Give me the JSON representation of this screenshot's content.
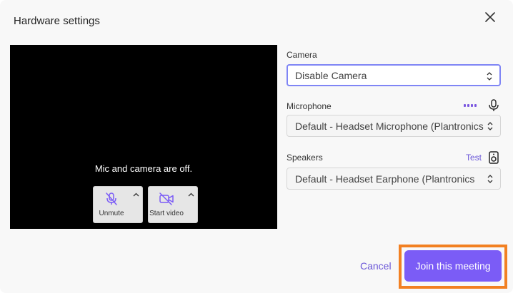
{
  "dialog": {
    "title": "Hardware settings"
  },
  "preview": {
    "message": "Mic and camera are off.",
    "controls": {
      "mic_label": "Unmute",
      "video_label": "Start video"
    }
  },
  "camera": {
    "label": "Camera",
    "selected": "Disable Camera"
  },
  "microphone": {
    "label": "Microphone",
    "selected": "Default - Headset Microphone (Plantronics"
  },
  "speakers": {
    "label": "Speakers",
    "test_label": "Test",
    "selected": "Default - Headset Earphone (Plantronics"
  },
  "footer": {
    "cancel_label": "Cancel",
    "join_label": "Join this meeting"
  },
  "colors": {
    "accent": "#7b5cf6",
    "link": "#6b57d8",
    "highlight": "#f28022",
    "focus_border": "#7f85f5"
  },
  "icons": [
    "close-icon",
    "mic-off-icon",
    "video-off-icon",
    "chevron-up-icon",
    "mic-icon",
    "speaker-icon",
    "select-arrows-icon"
  ]
}
